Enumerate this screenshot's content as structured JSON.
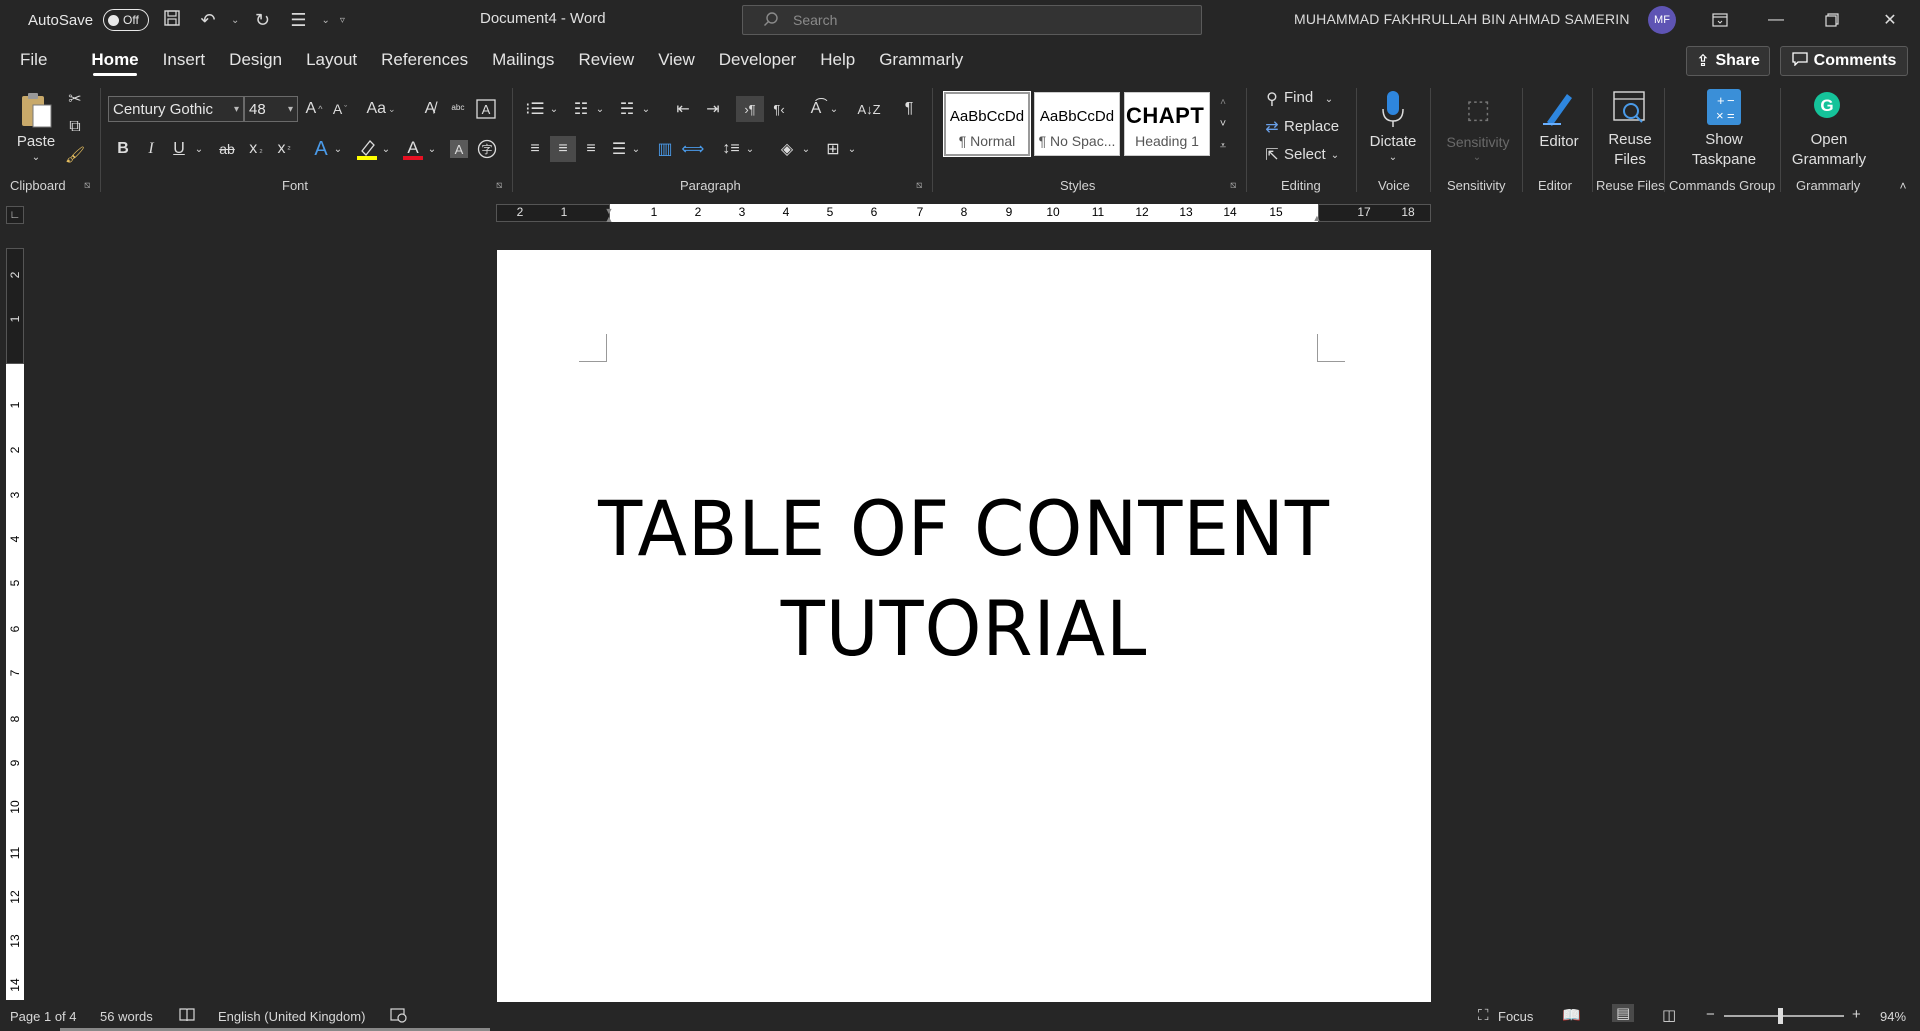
{
  "titlebar": {
    "autosave_label": "AutoSave",
    "autosave_state": "Off",
    "document_title": "Document4  -  Word",
    "search_placeholder": "Search",
    "user_name": "MUHAMMAD FAKHRULLAH BIN AHMAD SAMERIN",
    "user_initials": "MF"
  },
  "menu": {
    "tabs": [
      "File",
      "Home",
      "Insert",
      "Design",
      "Layout",
      "References",
      "Mailings",
      "Review",
      "View",
      "Developer",
      "Help",
      "Grammarly"
    ],
    "active": "Home",
    "share_label": "Share",
    "comments_label": "Comments"
  },
  "ribbon": {
    "clipboard": {
      "paste_label": "Paste",
      "group_label": "Clipboard"
    },
    "font": {
      "font_name": "Century Gothic",
      "font_size": "48",
      "group_label": "Font"
    },
    "paragraph": {
      "group_label": "Paragraph"
    },
    "styles": {
      "group_label": "Styles",
      "items": [
        {
          "sample": "AaBbCcDd",
          "name": "¶ Normal"
        },
        {
          "sample": "AaBbCcDd",
          "name": "¶ No Spac..."
        },
        {
          "sample": "CHAPT",
          "name": "Heading 1"
        }
      ]
    },
    "editing": {
      "find": "Find",
      "replace": "Replace",
      "select": "Select",
      "group_label": "Editing"
    },
    "voice": {
      "dictate": "Dictate",
      "group_label": "Voice"
    },
    "sensitivity": {
      "button": "Sensitivity",
      "group_label": "Sensitivity"
    },
    "editor": {
      "button": "Editor",
      "group_label": "Editor"
    },
    "reuse": {
      "button_line1": "Reuse",
      "button_line2": "Files",
      "group_label": "Reuse Files"
    },
    "commands": {
      "button_line1": "Show",
      "button_line2": "Taskpane",
      "group_label": "Commands Group"
    },
    "grammarly": {
      "button_line1": "Open",
      "button_line2": "Grammarly",
      "group_label": "Grammarly"
    }
  },
  "ruler": {
    "horizontal_left": [
      "2",
      "1"
    ],
    "horizontal": [
      "1",
      "2",
      "3",
      "4",
      "5",
      "6",
      "7",
      "8",
      "9",
      "10",
      "11",
      "12",
      "13",
      "14",
      "15"
    ],
    "horizontal_right": [
      "17",
      "18"
    ],
    "vertical_top": [
      "2",
      "1"
    ],
    "vertical": [
      "1",
      "2",
      "3",
      "4",
      "5",
      "6",
      "7",
      "8",
      "9",
      "10",
      "11",
      "12",
      "13",
      "14"
    ]
  },
  "document": {
    "line1": "TABLE OF CONTENT",
    "line2": "TUTORIAL"
  },
  "status": {
    "page": "Page 1 of 4",
    "words": "56 words",
    "language": "English (United Kingdom)",
    "focus": "Focus",
    "zoom": "94%"
  },
  "colors": {
    "background": "#262626",
    "avatar": "#5e54b4",
    "dictate_blue": "#2e86de",
    "grammarly_green": "#15c39a"
  }
}
